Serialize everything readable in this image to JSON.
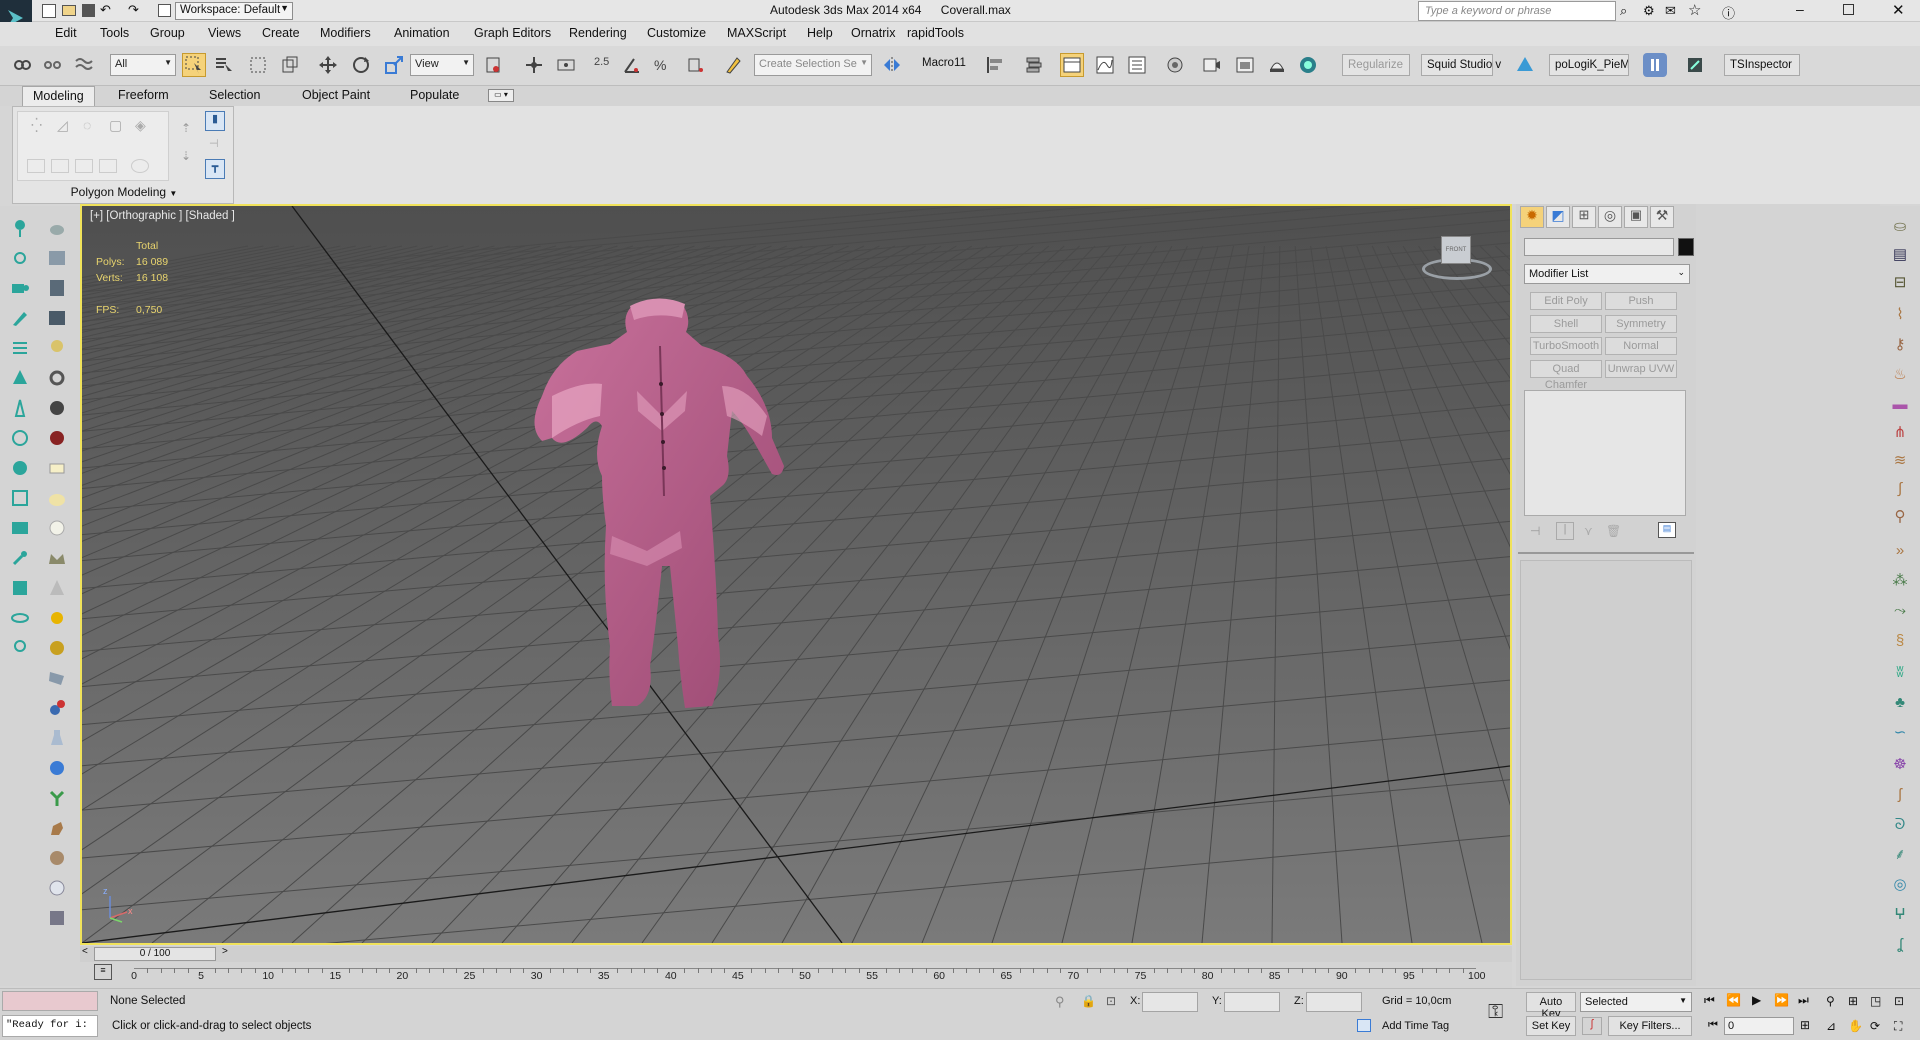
{
  "title": {
    "workspace_label": "Workspace: Default",
    "app": "Autodesk 3ds Max  2014 x64",
    "file": "Coverall.max",
    "search_placeholder": "Type a keyword or phrase"
  },
  "menu": [
    "Edit",
    "Tools",
    "Group",
    "Views",
    "Create",
    "Modifiers",
    "Animation",
    "Graph Editors",
    "Rendering",
    "Customize",
    "MAXScript",
    "Help",
    "Ornatrix",
    "rapidTools"
  ],
  "toolbar": {
    "filter_select": "All",
    "ref_coord_select": "View",
    "snap_label": "2.5",
    "selection_set_placeholder": "Create Selection Se",
    "macro_label": "Macro11",
    "regularize": "Regularize",
    "squid": "Squid Studio v",
    "plugin": "poLogiK_PieMe",
    "tsinspector": "TSInspector"
  },
  "ribbon": {
    "tabs": [
      "Modeling",
      "Freeform",
      "Selection",
      "Object Paint",
      "Populate"
    ],
    "active_tab": "Modeling",
    "panel_label": "Polygon Modeling"
  },
  "viewport": {
    "label": "[+] [Orthographic ] [Shaded ]",
    "stats": {
      "header": "Total",
      "polys_label": "Polys:",
      "polys_value": "16 089",
      "verts_label": "Verts:",
      "verts_value": "16 108",
      "fps_label": "FPS:",
      "fps_value": "0,750"
    },
    "viewcube_label": "FRONT",
    "axis_x": "x",
    "axis_z": "z"
  },
  "command_panel": {
    "modifier_list": "Modifier List",
    "buttons": [
      "Edit Poly",
      "Push",
      "Shell",
      "Symmetry",
      "TurboSmooth",
      "Normal",
      "Quad Chamfer",
      "Unwrap UVW"
    ]
  },
  "time": {
    "slider_label": "0 / 100",
    "ticks": [
      "0",
      "5",
      "10",
      "15",
      "20",
      "25",
      "30",
      "35",
      "40",
      "45",
      "50",
      "55",
      "60",
      "65",
      "70",
      "75",
      "80",
      "85",
      "90",
      "95",
      "100"
    ]
  },
  "status": {
    "script_listener": "\"Ready for i:",
    "selection": "None Selected",
    "prompt": "Click or click-and-drag to select objects",
    "x_label": "X:",
    "y_label": "Y:",
    "z_label": "Z:",
    "grid": "Grid = 10,0cm",
    "add_time_tag": "Add Time Tag",
    "auto_key": "Auto Key",
    "set_key": "Set Key",
    "key_mode_select": "Selected",
    "key_filters": "Key Filters...",
    "frame": "0"
  },
  "colors": {
    "viewport_border": "#f0e25a",
    "stats_text": "#e8d46e",
    "coverall": "#b55a86"
  }
}
